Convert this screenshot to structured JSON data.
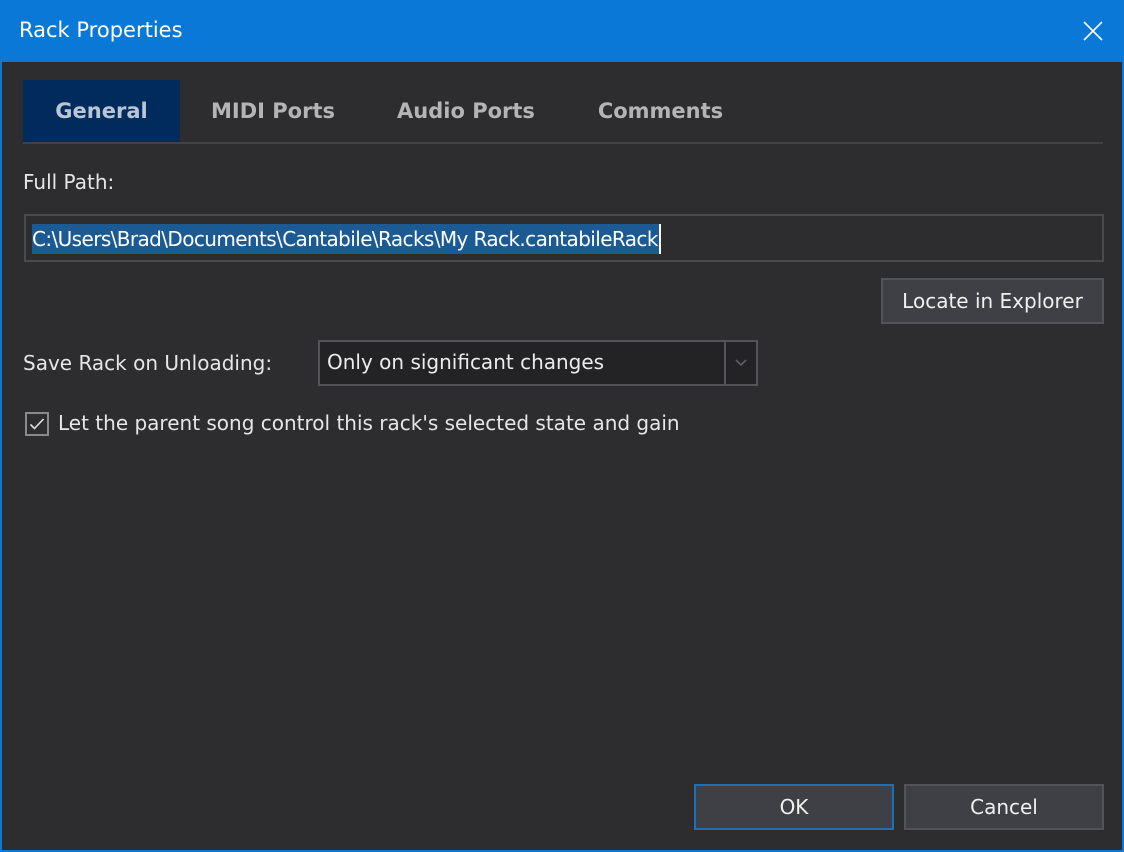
{
  "window": {
    "title": "Rack Properties",
    "close_icon": "close-icon"
  },
  "tabs": [
    {
      "label": "General",
      "active": true
    },
    {
      "label": "MIDI Ports",
      "active": false
    },
    {
      "label": "Audio Ports",
      "active": false
    },
    {
      "label": "Comments",
      "active": false
    }
  ],
  "general": {
    "full_path_label": "Full Path:",
    "full_path_value": "C:\\Users\\Brad\\Documents\\Cantabile\\Racks\\My Rack.cantabileRack",
    "locate_button": "Locate in Explorer",
    "save_rack_label": "Save Rack on Unloading:",
    "save_rack_selected": "Only on significant changes",
    "parent_control_checkbox": {
      "label": "Let the parent song control this rack's selected state and gain",
      "checked": true
    }
  },
  "footer": {
    "ok_label": "OK",
    "cancel_label": "Cancel"
  },
  "colors": {
    "accent": "#0a78d7",
    "active_tab": "#002b5c",
    "selection": "#1b5a93",
    "background": "#2d2d30"
  }
}
